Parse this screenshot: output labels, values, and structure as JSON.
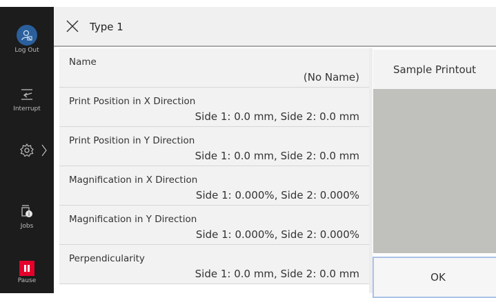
{
  "sidebar": {
    "logout": {
      "label": "Log Out",
      "icon": "user-logout-icon"
    },
    "interrupt": {
      "label": "Interrupt",
      "icon": "interrupt-icon"
    },
    "settings": {
      "icon": "gear-icon",
      "chevron": "chevron-right-icon"
    },
    "jobs": {
      "label": "Jobs",
      "icon": "jobs-icon"
    },
    "pause": {
      "label": "Pause",
      "icon": "pause-icon",
      "color": "#e4002b"
    }
  },
  "header": {
    "title": "Type 1",
    "close_icon": "close-icon"
  },
  "settings_list": [
    {
      "label": "Name",
      "value": "(No Name)"
    },
    {
      "label": "Print Position in X Direction",
      "value": "Side 1: 0.0 mm, Side 2: 0.0 mm"
    },
    {
      "label": "Print Position in Y Direction",
      "value": "Side 1: 0.0 mm, Side 2: 0.0 mm"
    },
    {
      "label": "Magnification in X Direction",
      "value": "Side 1: 0.000%, Side 2: 0.000%"
    },
    {
      "label": "Magnification in Y Direction",
      "value": "Side 1: 0.000%, Side 2: 0.000%"
    },
    {
      "label": "Perpendicularity",
      "value": "Side 1: 0.0 mm, Side 2: 0.0 mm"
    }
  ],
  "preview": {
    "button_label": "Sample Printout"
  },
  "ok_label": "OK",
  "colors": {
    "sidebar_bg": "#1c1c1c",
    "logout_accent": "#2b5f9c",
    "pause_red": "#e4002b",
    "ok_border": "#a9c2e6",
    "preview_bg": "#c0c0bc"
  }
}
